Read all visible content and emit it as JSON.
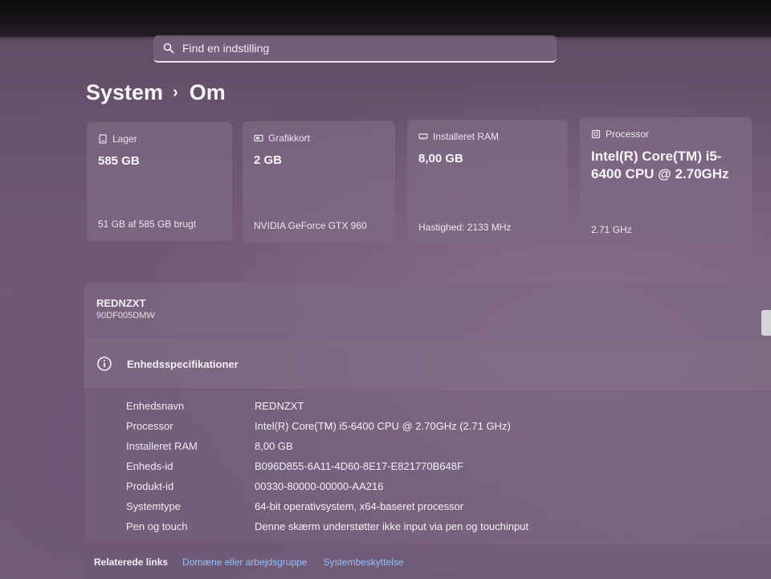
{
  "search": {
    "placeholder": "Find en indstilling"
  },
  "breadcrumb": {
    "parent": "System",
    "separator": "›",
    "current": "Om"
  },
  "cards": [
    {
      "title": "Lager",
      "icon": "storage-icon",
      "value": "585 GB",
      "footer": "51 GB af 585 GB brugt"
    },
    {
      "title": "Grafikkort",
      "icon": "gpu-icon",
      "value": "2 GB",
      "footer": "NVIDIA GeForce GTX 960"
    },
    {
      "title": "Installeret RAM",
      "icon": "ram-icon",
      "value": "8,00 GB",
      "footer": "Hastighed: 2133 MHz"
    },
    {
      "title": "Processor",
      "icon": "cpu-icon",
      "value": "Intel(R) Core(TM) i5-6400 CPU @ 2.70GHz",
      "footer": "2.71 GHz"
    }
  ],
  "device": {
    "name": "REDNZXT",
    "model": "90DF005DMW"
  },
  "specs": {
    "title": "Enhedsspecifikationer",
    "rows": [
      {
        "label": "Enhedsnavn",
        "value": "REDNZXT"
      },
      {
        "label": "Processor",
        "value": "Intel(R) Core(TM) i5-6400 CPU @ 2.70GHz (2.71 GHz)"
      },
      {
        "label": "Installeret RAM",
        "value": "8,00 GB"
      },
      {
        "label": "Enheds-id",
        "value": "B096D855-6A11-4D60-8E17-E821770B648F"
      },
      {
        "label": "Produkt-id",
        "value": "00330-80000-00000-AA216"
      },
      {
        "label": "Systemtype",
        "value": "64-bit operativsystem, x64-baseret processor"
      },
      {
        "label": "Pen og touch",
        "value": "Denne skærm understøtter ikke input via pen og touchinput"
      }
    ]
  },
  "related": {
    "label": "Relaterede links",
    "links": [
      "Domæne eller arbejdsgruppe",
      "Systembeskyttelse"
    ]
  },
  "colors": {
    "accent_link": "#8fc3ff"
  }
}
